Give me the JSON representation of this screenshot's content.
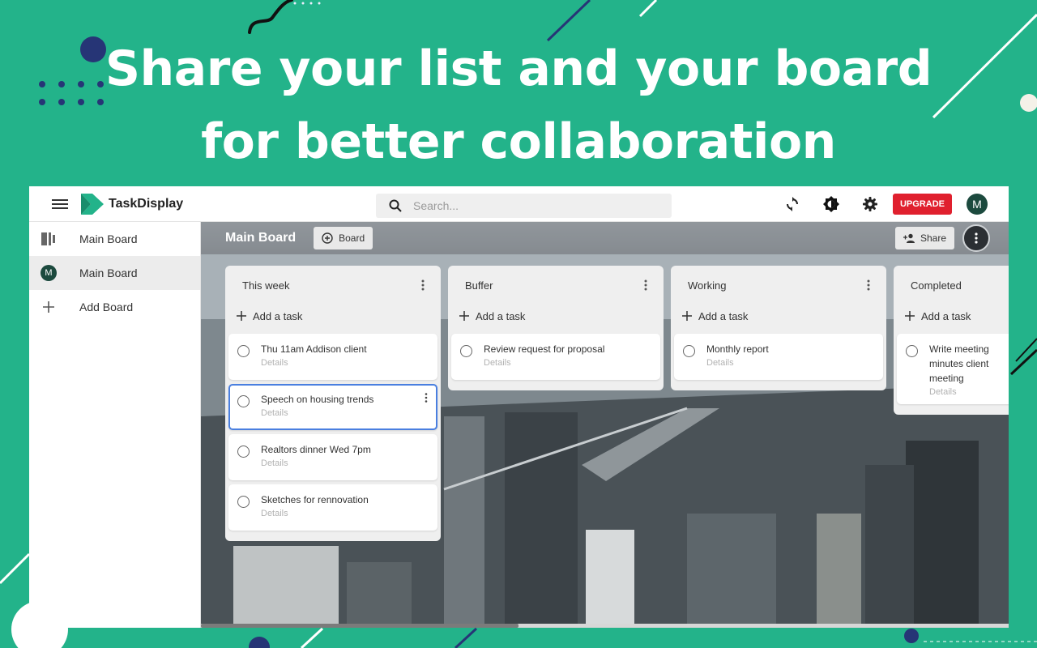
{
  "headline": {
    "line1": "Share your list and your board",
    "line2": "for better collaboration"
  },
  "app": {
    "name": "TaskDisplay",
    "search": {
      "placeholder": "Search...",
      "value": ""
    },
    "upgrade_label": "UPGRADE",
    "avatar_initial": "M",
    "icons": {
      "menu": "hamburger-icon",
      "sync": "sync-icon",
      "theme": "brightness-icon",
      "settings": "gear-icon"
    },
    "colors": {
      "brand": "#23b38a",
      "upgrade": "#e0202e",
      "avatar": "#1c4a3e",
      "selected_border": "#4a7fe0"
    }
  },
  "sidebar": {
    "items": [
      {
        "label": "Main Board",
        "icon": "board-view-icon",
        "active": false
      },
      {
        "label": "Main Board",
        "icon": "avatar",
        "initial": "M",
        "active": true
      },
      {
        "label": "Add Board",
        "icon": "plus-icon",
        "active": false
      }
    ]
  },
  "board": {
    "title": "Main Board",
    "view_button": "Board",
    "share_button": "Share",
    "columns": [
      {
        "title": "This week",
        "add_label": "Add a task",
        "tasks": [
          {
            "title": "Thu 11am Addison client",
            "details": "Details"
          },
          {
            "title": "Speech on housing trends",
            "details": "Details",
            "selected": true
          },
          {
            "title": "Realtors dinner Wed 7pm",
            "details": "Details"
          },
          {
            "title": "Sketches for rennovation",
            "details": "Details"
          }
        ]
      },
      {
        "title": "Buffer",
        "add_label": "Add a task",
        "tasks": [
          {
            "title": "Review request for proposal",
            "details": "Details"
          }
        ]
      },
      {
        "title": "Working",
        "add_label": "Add a task",
        "tasks": [
          {
            "title": "Monthly report",
            "details": "Details"
          }
        ]
      },
      {
        "title": "Completed",
        "add_label": "Add a task",
        "tasks": [
          {
            "title": "Write meeting minutes client meeting",
            "details": "Details"
          }
        ]
      }
    ]
  }
}
